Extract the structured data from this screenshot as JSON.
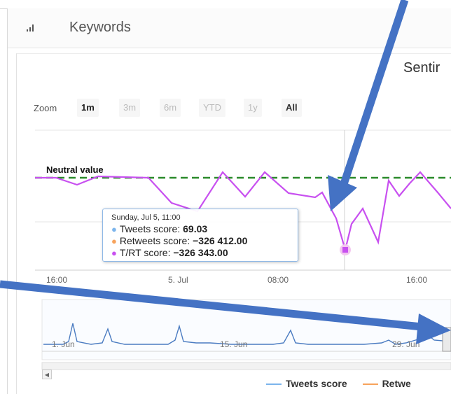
{
  "panel": {
    "title": "Keywords"
  },
  "chart": {
    "title": "Sentir",
    "zoom": {
      "label": "Zoom",
      "buttons": [
        "1m",
        "3m",
        "6m",
        "YTD",
        "1y",
        "All"
      ],
      "active": "1m"
    },
    "neutral_label": "Neutral value",
    "x_ticks": [
      "16:00",
      "5. Jul",
      "08:00",
      "16:00"
    ],
    "navigator_ticks": [
      "1. Jun",
      "15. Jun",
      "29. Jun"
    ],
    "legend": [
      "Tweets score",
      "Retwe"
    ]
  },
  "tooltip": {
    "date": "Sunday, Jul 5, 11:00",
    "rows": [
      {
        "label": "Tweets score: ",
        "value": "69.03"
      },
      {
        "label": "Retweets score: ",
        "value": "−326 412.00"
      },
      {
        "label": "T/RT score: ",
        "value": "−326 343.00"
      }
    ]
  },
  "colors": {
    "tweets": "#7cb5ec",
    "retweets": "#f7a35c",
    "trt": "#c850f0",
    "neutral": "#2a8a2a",
    "arrow": "#4472c4"
  },
  "chart_data": {
    "type": "line",
    "series": [
      {
        "name": "T/RT score",
        "values": [
          0,
          -0.2,
          0,
          0,
          -0.6,
          -0.2,
          0.1,
          -0.1,
          -0.2,
          -0.2,
          0.3,
          -0.2,
          -0.3,
          -0.4,
          -1.3,
          -0.7,
          -0.9,
          -0.1,
          -0.3,
          -0.5,
          0.1,
          -0.1,
          0.1,
          -0.3,
          -0.6
        ]
      }
    ]
  }
}
